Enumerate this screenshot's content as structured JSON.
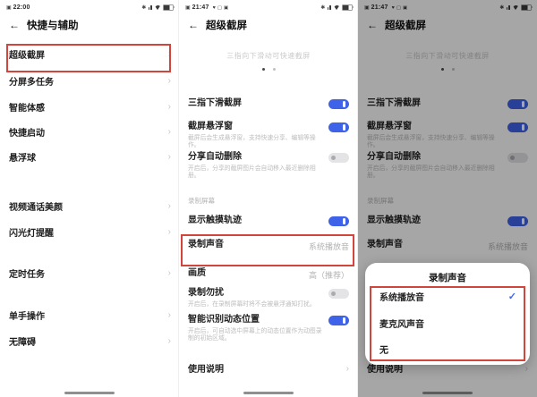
{
  "glyphs": {
    "chevron": "›",
    "back_arrow": "←",
    "check": "✓",
    "nfc": "✱",
    "device": "▣",
    "app1": "♥",
    "app2": "▢",
    "app3": "▣"
  },
  "colors": {
    "accent_blue": "#3E63E9",
    "annotation_red": "#D2453C",
    "check_blue": "#3E6BE8",
    "toggle_off": "#E4E4E6"
  },
  "panel1": {
    "status": {
      "time": "22:00"
    },
    "header": {
      "title": "快捷与辅助"
    },
    "items": [
      {
        "label": "超级截屏"
      },
      {
        "label": "分屏多任务"
      },
      {
        "label": "智能体感"
      },
      {
        "label": "快捷启动"
      },
      {
        "label": "悬浮球"
      },
      {
        "label": "视频通话美颜"
      },
      {
        "label": "闪光灯提醒"
      },
      {
        "label": "定时任务"
      },
      {
        "label": "单手操作"
      },
      {
        "label": "无障碍"
      }
    ]
  },
  "screen2": {
    "status": {
      "time": "21:47"
    },
    "header": {
      "title": "超级截屏"
    },
    "hint": "三指向下滑动可快速截屏",
    "section_label": "录制屏幕",
    "rows": {
      "three_finger": {
        "title": "三指下滑截屏",
        "state": "on"
      },
      "float_window": {
        "title": "截屏悬浮窗",
        "subtitle": "截屏后会生成悬浮窗，支持快速分享、编辑等操作。",
        "state": "on"
      },
      "auto_delete": {
        "title": "分享自动删除",
        "subtitle": "开启后，分享的截屏图片会自动移入最近删除相册。",
        "state": "off"
      },
      "touch_trail": {
        "title": "显示触摸轨迹",
        "state": "on"
      },
      "record_sound": {
        "title": "录制声音",
        "value": "系统播放音"
      },
      "quality": {
        "title": "画质",
        "value": "高（推荐）"
      },
      "record_dnd": {
        "title": "录制勿扰",
        "subtitle": "开启后，在录制屏幕时将不会被悬浮通知打扰。",
        "state": "off"
      },
      "smart_region": {
        "title": "智能识别动态位置",
        "subtitle": "开启后，可自动选中屏幕上的动态位置作为动图录制的初始区域。",
        "state": "on"
      },
      "usage": {
        "title": "使用说明"
      }
    }
  },
  "modal": {
    "title": "录制声音",
    "options": [
      {
        "label": "系统播放音",
        "selected": true
      },
      {
        "label": "麦克风声音",
        "selected": false
      },
      {
        "label": "无",
        "selected": false
      }
    ]
  }
}
